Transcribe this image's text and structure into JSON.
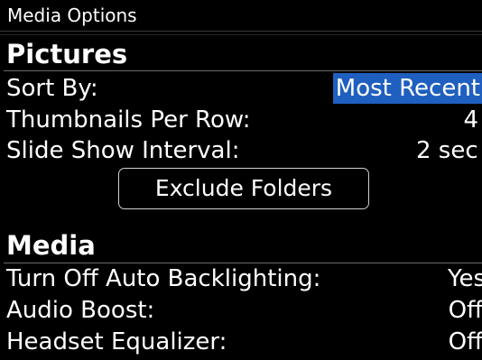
{
  "header": {
    "title": "Media Options"
  },
  "pictures": {
    "heading": "Pictures",
    "sort_by": {
      "label": "Sort By:",
      "value": "Most Recent"
    },
    "thumbnails_per_row": {
      "label": "Thumbnails Per Row:",
      "value": "4"
    },
    "slide_show_interval": {
      "label": "Slide Show Interval:",
      "value": "2 sec"
    },
    "exclude_folders_label": "Exclude Folders"
  },
  "media": {
    "heading": "Media",
    "auto_backlighting": {
      "label": "Turn Off Auto Backlighting:",
      "value": "Yes"
    },
    "audio_boost": {
      "label": "Audio Boost:",
      "value": "Off"
    },
    "headset_equalizer": {
      "label": "Headset Equalizer:",
      "value": "Off"
    }
  },
  "colors": {
    "background": "#000000",
    "text": "#ffffff",
    "selection": "#1f5fbf"
  }
}
